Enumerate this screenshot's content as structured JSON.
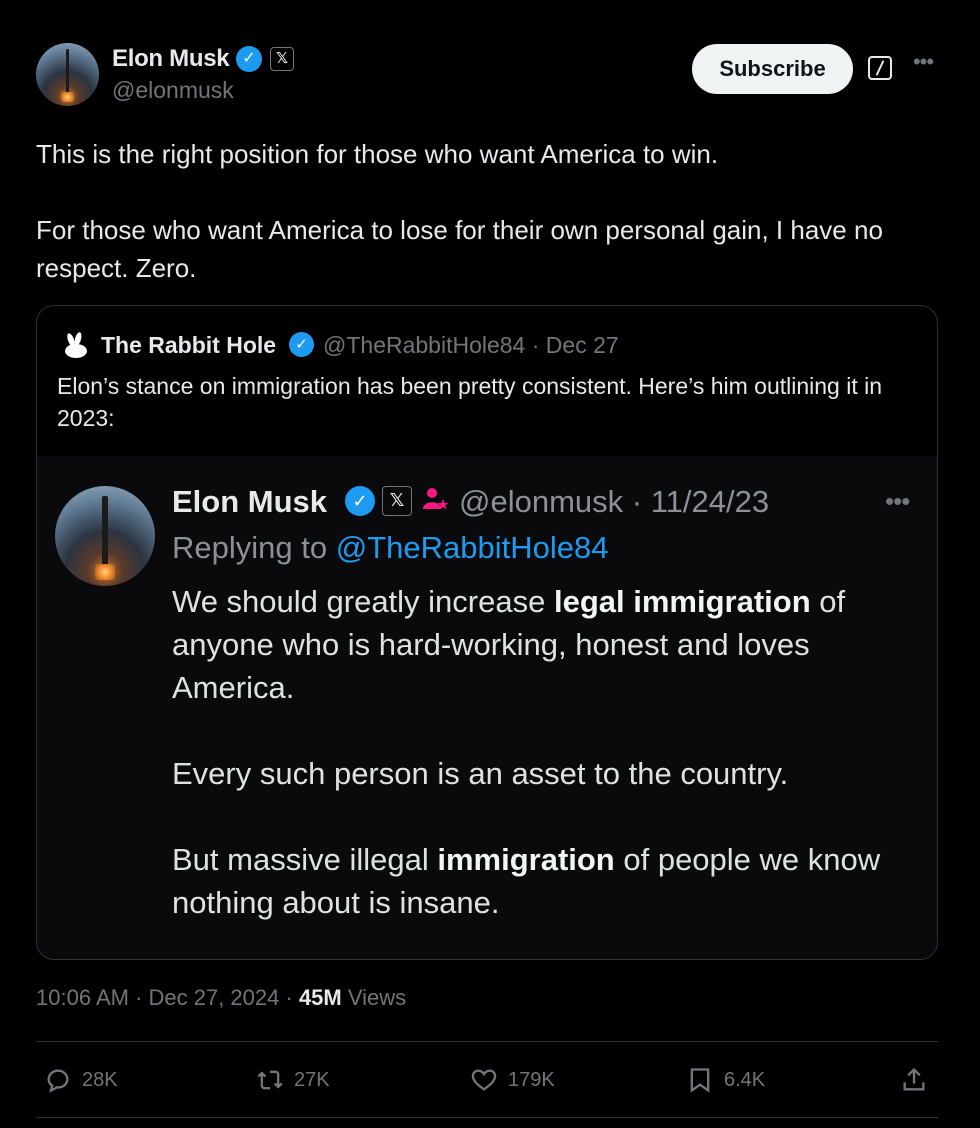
{
  "post": {
    "author": {
      "name": "Elon Musk",
      "handle": "@elonmusk",
      "verified_mark": "✓",
      "affiliation_badge": "𝕏"
    },
    "subscribe_label": "Subscribe",
    "more_label": "•••",
    "text": [
      "This is the right position for those who want America to win.",
      "For those who want America to lose for their own personal gain, I have no respect. Zero."
    ],
    "quote": {
      "author_name": "The Rabbit Hole",
      "handle_date": "@TheRabbitHole84 · Dec 27",
      "text": "Elon’s stance on immigration has been pretty consistent. Here’s him outlining it in 2023:",
      "embedded": {
        "author_name": "Elon Musk",
        "handle_date": "@elonmusk · 11/24/23",
        "more_label": "•••",
        "replying_prefix": "Replying to ",
        "replying_to": "@TheRabbitHole84",
        "para1_a": "We should greatly increase ",
        "para1_bold": "legal immigration",
        "para1_b": " of anyone who is hard-working, honest and loves America.",
        "para2": "Every such person is an asset to the country.",
        "para3_a": "But massive illegal ",
        "para3_bold": "immigration",
        "para3_b": " of people we know nothing about is insane."
      }
    },
    "meta": {
      "timestamp": "10:06 AM · Dec 27, 2024 · ",
      "views_count": "45M",
      "views_label": " Views"
    },
    "actions": {
      "replies": "28K",
      "reposts": "27K",
      "likes": "179K",
      "bookmarks": "6.4K"
    }
  },
  "colors": {
    "background": "#000000",
    "accent": "#1d9bf0",
    "muted": "#71767b",
    "text": "#e7e9ea",
    "affiliation": "#f91880"
  },
  "icons": [
    "verified-badge-icon",
    "x-affiliation-icon",
    "grok-icon",
    "more-icon",
    "rabbit-icon",
    "reply-icon",
    "repost-icon",
    "like-icon",
    "bookmark-icon",
    "share-icon"
  ]
}
